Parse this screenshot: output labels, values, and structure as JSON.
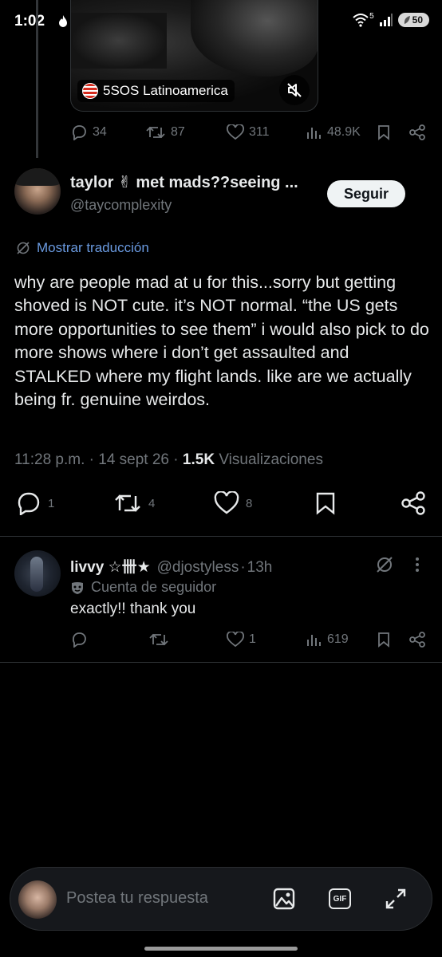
{
  "status_bar": {
    "time": "1:02",
    "battery": "50",
    "network": "5"
  },
  "quoted_media": {
    "source_label": "5SOS Latinoamerica"
  },
  "parent_actions": {
    "replies": "34",
    "reposts": "87",
    "likes": "311",
    "views": "48.9K"
  },
  "main_tweet": {
    "display_name": "taylor ✌ met mads??seeing ...",
    "handle": "@taycomplexity",
    "follow_label": "Seguir",
    "translate_label": "Mostrar traducción",
    "body": "why are people mad at u for this...sorry but getting shoved is NOT cute. it’s NOT normal. “the US gets more opportunities to see them” i would also pick to do more shows where i don’t get assaulted and STALKED where my flight lands. like are we actually being fr. genuine weirdos.",
    "time": "11:28 p.m.",
    "date": "14 sept 26",
    "views_count": "1.5K",
    "views_label": "Visualizaciones",
    "replies": "1",
    "reposts": "4",
    "likes": "8"
  },
  "reply": {
    "display_name": "livvy ☆卌★",
    "handle": "@djostyless",
    "age": "13h",
    "badge_label": "Cuenta de seguidor",
    "text": "exactly!! thank you",
    "likes": "1",
    "views": "619"
  },
  "composer": {
    "placeholder": "Postea tu respuesta",
    "gif_label": "GIF"
  },
  "colors": {
    "background": "#000000",
    "muted": "#71767b",
    "link": "#6a9ae0",
    "follow_bg": "#eff3f4"
  }
}
